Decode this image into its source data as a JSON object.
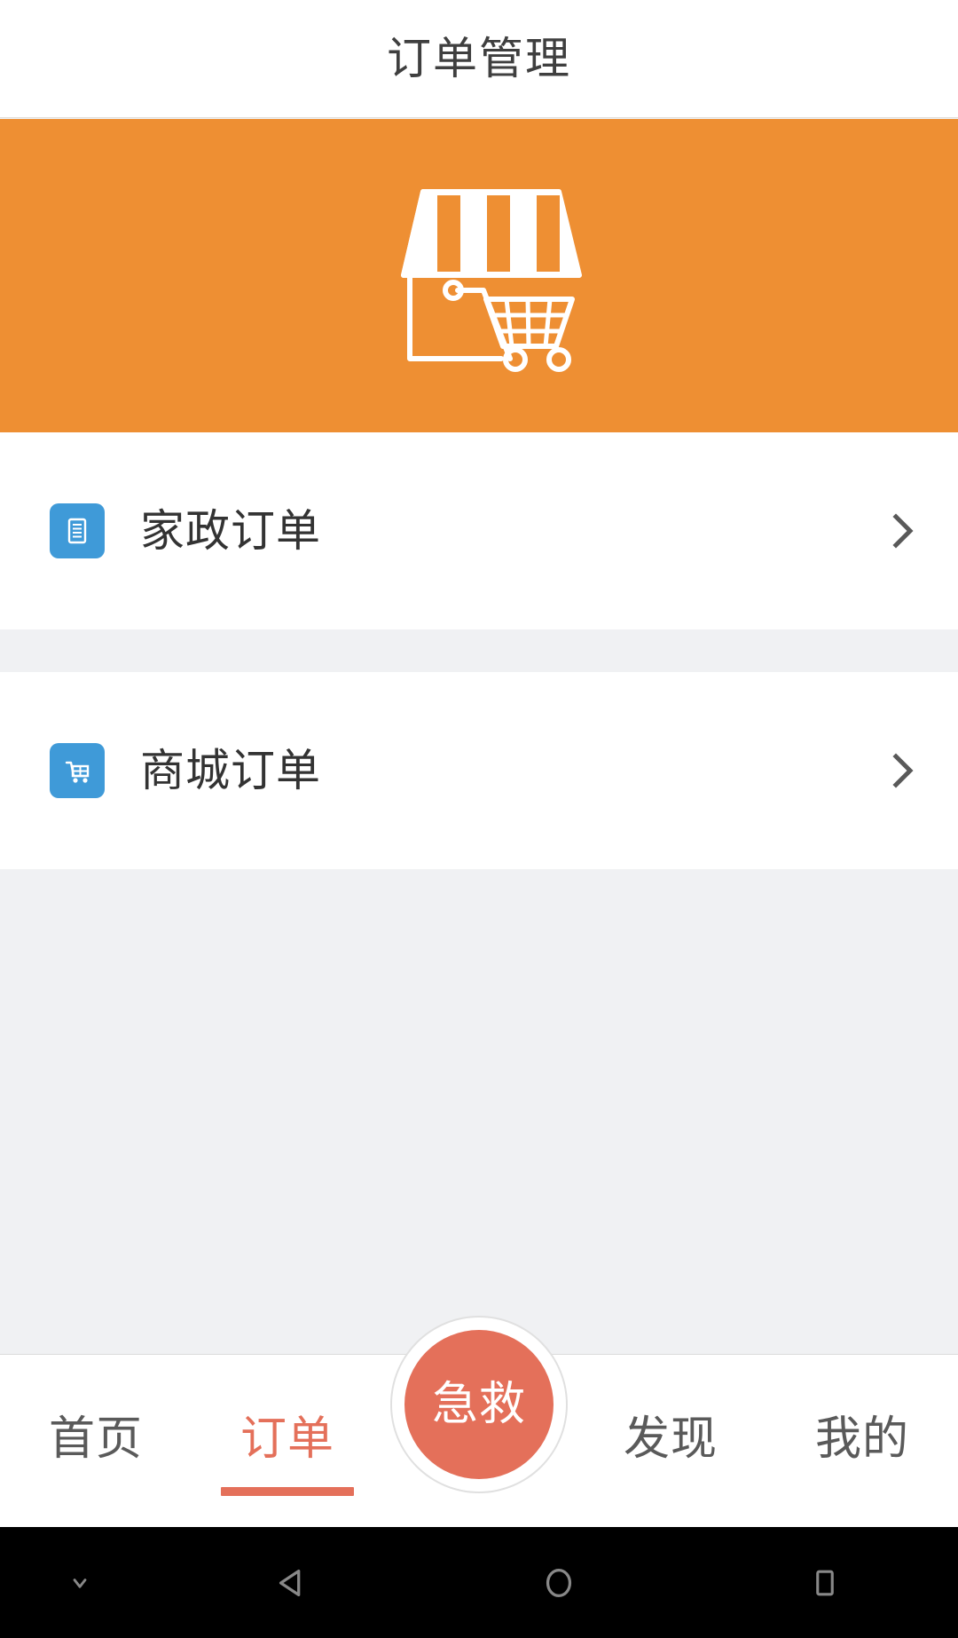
{
  "header": {
    "title": "订单管理"
  },
  "banner": {
    "icon": "storefront-cart-icon",
    "background_color": "#EE8F33"
  },
  "list": {
    "items": [
      {
        "label": "家政订单",
        "icon": "document-list-icon",
        "icon_color": "#3F9AD8",
        "chevron": "chevron-right-icon"
      },
      {
        "label": "商城订单",
        "icon": "shopping-cart-icon",
        "icon_color": "#3F9AD8",
        "chevron": "chevron-right-icon"
      }
    ]
  },
  "tabbar": {
    "active_color": "#E4705A",
    "inactive_color": "#5A5A5A",
    "tabs": [
      {
        "label": "首页",
        "active": false
      },
      {
        "label": "订单",
        "active": true
      },
      {
        "label": "发现",
        "active": false
      },
      {
        "label": "我的",
        "active": false
      }
    ],
    "center": {
      "label": "急救",
      "color": "#E4705A"
    }
  },
  "navbar": {
    "buttons": [
      {
        "icon": "chevron-down-icon"
      },
      {
        "icon": "back-triangle-icon"
      },
      {
        "icon": "home-circle-icon"
      },
      {
        "icon": "recents-square-icon"
      }
    ]
  }
}
